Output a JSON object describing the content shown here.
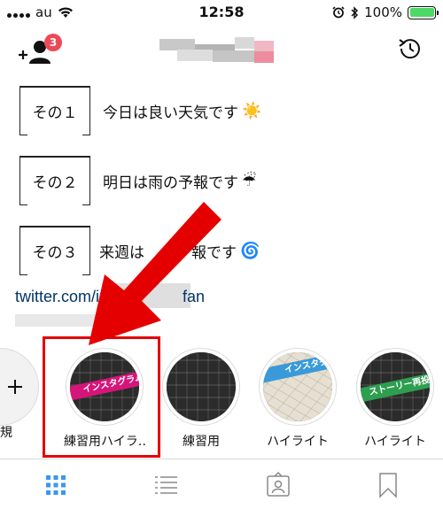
{
  "status_bar": {
    "carrier": "au",
    "time": "12:58",
    "battery_percent": "100%",
    "battery_color": "#4cd964"
  },
  "header": {
    "notification_badge": "3",
    "left_icon": "add-person-icon",
    "right_icon": "history-icon"
  },
  "bio": {
    "lines": [
      {
        "label": "その１",
        "text": "今日は良い天気です",
        "emoji": "☀️"
      },
      {
        "label": "その２",
        "text": "明日は雨の予報です",
        "emoji": "☔"
      },
      {
        "label": "その３",
        "text": "来週は",
        "emoji": "🌀"
      }
    ],
    "line3_suffix": "報です",
    "link": "twitter.com/in",
    "link_suffix": "fan"
  },
  "highlights": {
    "new_label": "新規",
    "items": [
      {
        "label": "練習用ハイラ…",
        "tag": "インスタグラム",
        "tag_color": "#d6157a"
      },
      {
        "label": "練習用",
        "tag": "",
        "tag_color": ""
      },
      {
        "label": "ハイライト",
        "tag": "インスタグ",
        "tag_color": "#3a9ad9"
      },
      {
        "label": "ハイライト",
        "tag": "ストーリー再投稿",
        "tag_color": "#2e9e4f"
      }
    ]
  },
  "annotation": {
    "color": "#e50000"
  },
  "tab_bar": {
    "tabs": [
      "grid-icon",
      "list-icon",
      "tagged-icon",
      "saved-icon"
    ],
    "active_color": "#3897f0"
  }
}
